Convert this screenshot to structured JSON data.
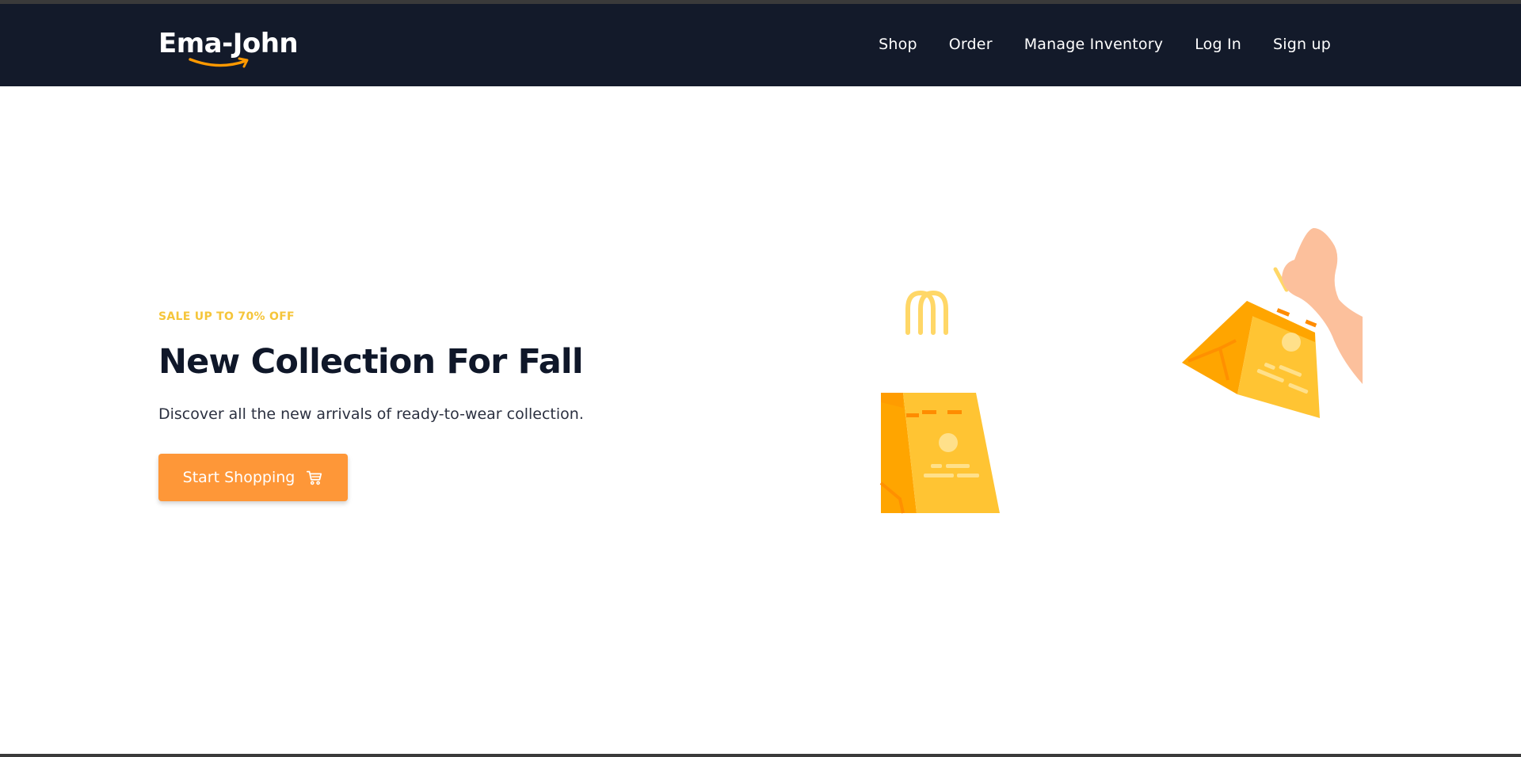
{
  "brand": {
    "name": "Ema-John",
    "accent_color": "#ff9900"
  },
  "nav": {
    "items": [
      {
        "label": "Shop"
      },
      {
        "label": "Order"
      },
      {
        "label": "Manage Inventory"
      },
      {
        "label": "Log In"
      },
      {
        "label": "Sign up"
      }
    ]
  },
  "hero": {
    "tag": "SALE UP TO 70% OFF",
    "title": "New Collection For Fall",
    "description": "Discover all the new arrivals of ready-to-wear collection.",
    "cta_label": "Start Shopping",
    "cta_icon": "cart-icon",
    "illustration": "shopping-bags-illustration"
  },
  "colors": {
    "navbar_bg": "#131a2a",
    "tag": "#f5c53a",
    "title": "#0f1729",
    "button": "#fe9738",
    "bag_yellow": "#ffc433",
    "bag_orange": "#ffa500",
    "skin": "#fcc09c"
  }
}
